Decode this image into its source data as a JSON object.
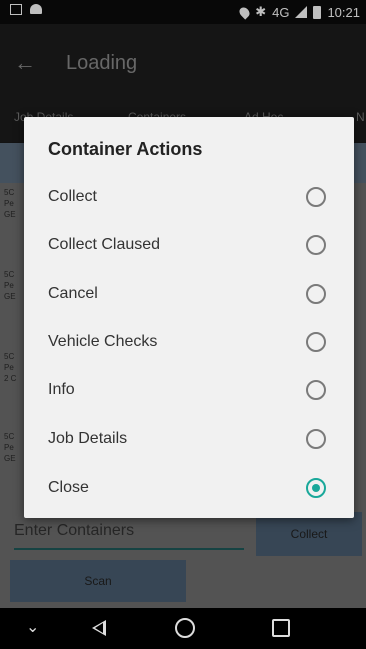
{
  "status_bar": {
    "time": "10:21",
    "network": "4G",
    "icons": [
      "message-icon",
      "android-icon",
      "location-icon",
      "bluetooth-icon",
      "signal-icon",
      "battery-icon"
    ]
  },
  "app_bar": {
    "title": "Loading"
  },
  "tabs": [
    {
      "label": "Job Details"
    },
    {
      "label": "Containers"
    },
    {
      "label": "Ad Hoc"
    },
    {
      "label": "N"
    }
  ],
  "background_rows": [
    [
      "5C",
      "Pe",
      "GE"
    ],
    [
      "5C",
      "Pe",
      "GE"
    ],
    [
      "5C",
      "Pe",
      "2 C"
    ],
    [
      "5C",
      "Pe",
      "GE"
    ]
  ],
  "bottom": {
    "input_placeholder": "Enter Containers",
    "collect_label": "Collect",
    "scan_label": "Scan"
  },
  "dialog": {
    "title": "Container Actions",
    "options": [
      {
        "label": "Collect",
        "selected": false
      },
      {
        "label": "Collect Claused",
        "selected": false
      },
      {
        "label": "Cancel",
        "selected": false
      },
      {
        "label": "Vehicle Checks",
        "selected": false
      },
      {
        "label": "Info",
        "selected": false
      },
      {
        "label": "Job Details",
        "selected": false
      },
      {
        "label": "Close",
        "selected": true
      }
    ]
  },
  "colors": {
    "accent": "#19a89a",
    "button": "#4a5e72"
  }
}
